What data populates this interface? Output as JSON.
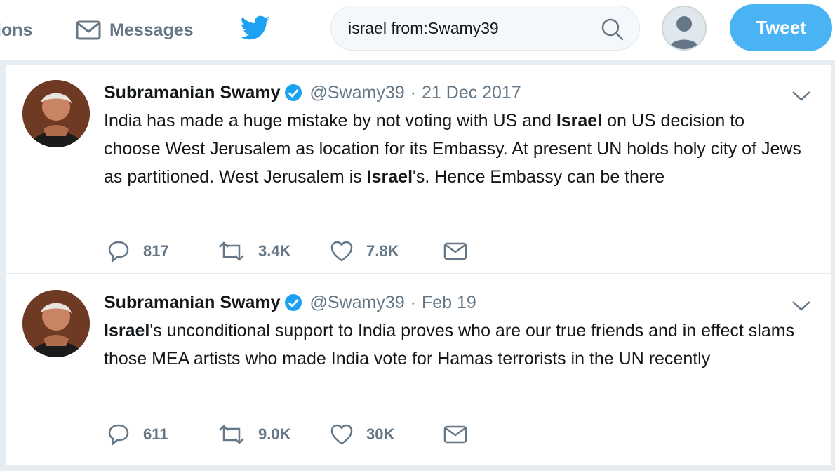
{
  "nav": {
    "notifications_label": "ions",
    "messages_label": "Messages"
  },
  "search": {
    "query": "israel from:Swamy39"
  },
  "compose": {
    "tweet_button_label": "Tweet"
  },
  "colors": {
    "brand_blue": "#1da1f2",
    "tweet_button": "#4ab3f4",
    "secondary_text": "#657786"
  },
  "icons": [
    "envelope-icon",
    "twitter-bird-icon",
    "search-icon",
    "profile-avatar",
    "verified-badge-icon",
    "caret-down-icon",
    "reply-icon",
    "retweet-icon",
    "like-icon",
    "direct-message-icon"
  ],
  "tweets": [
    {
      "fullname": "Subramanian Swamy",
      "handle": "@Swamy39",
      "separator": "·",
      "time": "21 Dec 2017",
      "text_parts": [
        "India has made a huge mistake by not voting with US and ",
        "Israel",
        " on US decision to choose West Jerusalem as location for its Embassy. At present UN holds holy city of Jews as partitioned. West Jerusalem is ",
        "Israel",
        "'s. Hence Embassy can be there"
      ],
      "replies": "817",
      "retweets": "3.4K",
      "likes": "7.8K"
    },
    {
      "fullname": "Subramanian Swamy",
      "handle": "@Swamy39",
      "separator": "·",
      "time": "Feb 19",
      "text_parts": [
        "Israel",
        "'s unconditional support to India proves who are our true friends and in effect slams those MEA artists who made India vote for Hamas terrorists in the UN recently"
      ],
      "replies": "611",
      "retweets": "9.0K",
      "likes": "30K"
    }
  ]
}
